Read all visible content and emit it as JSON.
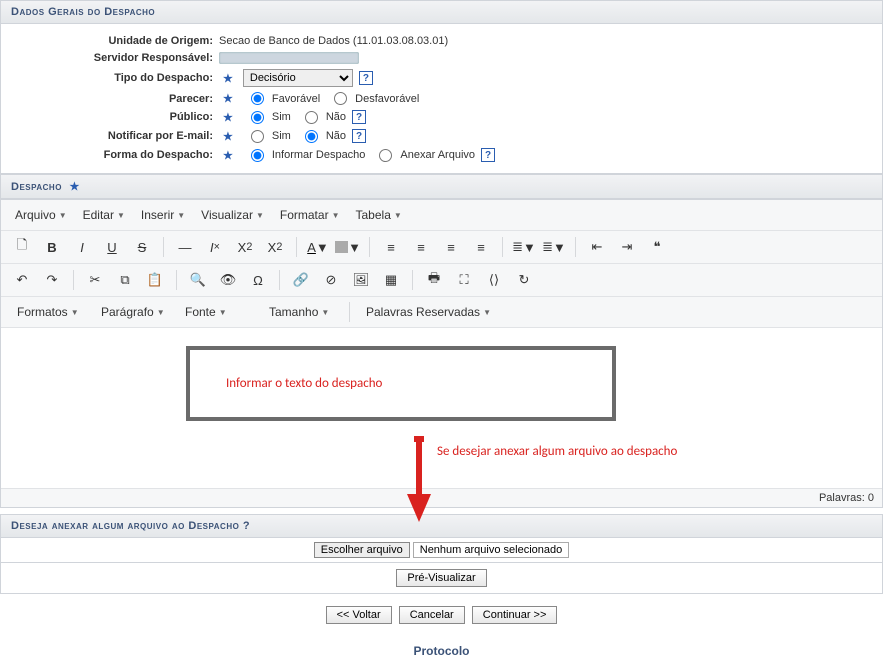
{
  "sections": {
    "dados_gerais": "Dados Gerais do Despacho",
    "despacho": "Despacho",
    "anexar": "Deseja anexar algum arquivo ao Despacho ?"
  },
  "form": {
    "unidade_label": "Unidade de Origem:",
    "unidade_value": "Secao de Banco de Dados (11.01.03.08.03.01)",
    "servidor_label": "Servidor Responsável:",
    "tipo_label": "Tipo do Despacho:",
    "tipo_value": "Decisório",
    "parecer_label": "Parecer:",
    "parecer_opts": {
      "fav": "Favorável",
      "desf": "Desfavorável"
    },
    "publico_label": "Público:",
    "yn": {
      "sim": "Sim",
      "nao": "Não"
    },
    "notificar_label": "Notificar por E-mail:",
    "forma_label": "Forma do Despacho:",
    "forma_opts": {
      "informar": "Informar Despacho",
      "anexar": "Anexar Arquivo"
    }
  },
  "menubar": {
    "arquivo": "Arquivo",
    "editar": "Editar",
    "inserir": "Inserir",
    "visualizar": "Visualizar",
    "formatar": "Formatar",
    "tabela": "Tabela"
  },
  "formatbar": {
    "formatos": "Formatos",
    "paragrafo": "Parágrafo",
    "fonte": "Fonte",
    "tamanho": "Tamanho",
    "palavras": "Palavras Reservadas"
  },
  "annotations": {
    "box": "Informar o texto do despacho",
    "arrow": "Se desejar anexar algum arquivo ao despacho"
  },
  "status": {
    "palavras_label": "Palavras:",
    "palavras_count": 0
  },
  "file": {
    "choose": "Escolher arquivo",
    "none": "Nenhum arquivo selecionado"
  },
  "buttons": {
    "previs": "Pré-Visualizar",
    "voltar": "<< Voltar",
    "cancelar": "Cancelar",
    "continuar": "Continuar >>"
  },
  "footer": "Protocolo"
}
